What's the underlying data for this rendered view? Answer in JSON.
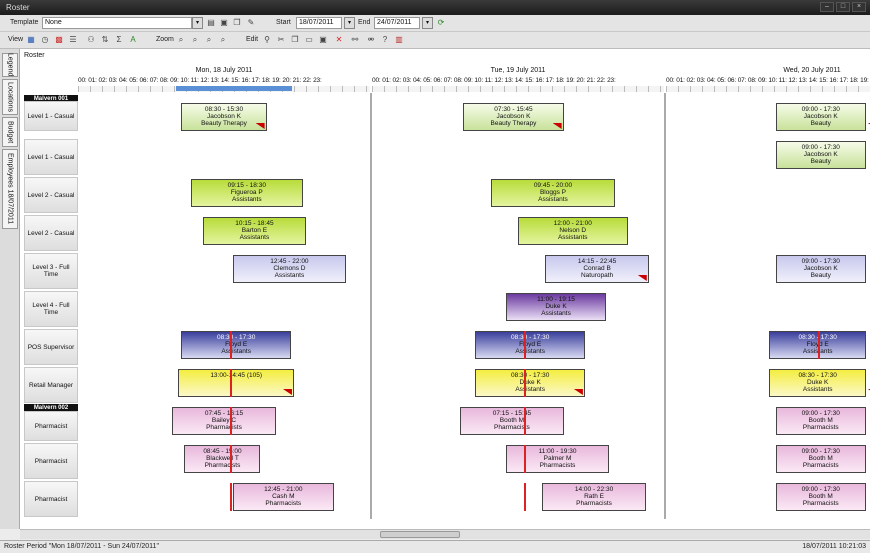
{
  "window": {
    "title": "Roster"
  },
  "toolbar1": {
    "template_label": "Template",
    "template_value": "None",
    "start_label": "Start",
    "start_value": "18/07/2011",
    "end_label": "End",
    "end_value": "24/07/2011"
  },
  "toolbar2": {
    "view_label": "View",
    "zoom_label": "Zoom",
    "edit_label": "Edit"
  },
  "sidetabs": [
    "Legend",
    "Locations",
    "Budget",
    "Employees 18/07/2011"
  ],
  "panel": {
    "title": "Roster"
  },
  "days": [
    "Mon, 18 July 2011",
    "Tue, 19 July 2011",
    "Wed, 20 July 2011"
  ],
  "hours": "00: 01: 02: 03: 04: 05: 06: 07: 08: 09: 10: 11: 12: 13: 14: 15: 16: 17: 18: 19: 20: 21: 22: 23:",
  "groups": [
    "Malvern 001",
    "Malvern 002"
  ],
  "rows": [
    "Level 1 - Casual",
    "Level 1 - Casual",
    "Level 2 - Casual",
    "Level 2 - Casual",
    "Level 3 - Full Time",
    "Level 4 - Full Time",
    "POS Supervisor",
    "Retail Manager",
    "Pharmacist",
    "Pharmacist",
    "Pharmacist"
  ],
  "shifts": [
    {
      "row": 0,
      "day": 0,
      "start": 8.5,
      "end": 15.5,
      "time": "08:30 - 15:30",
      "name": "Jacobson K",
      "role": "Beauty Therapy",
      "color": "green"
    },
    {
      "row": 0,
      "day": 1,
      "start": 7.5,
      "end": 15.75,
      "time": "07:30 - 15:45",
      "name": "Jacobson K",
      "role": "Beauty Therapy",
      "color": "green"
    },
    {
      "row": 0,
      "day": 2,
      "start": 9,
      "end": 17.5,
      "time": "09:00 - 17:30",
      "name": "Jacobson K",
      "role": "Beauty",
      "color": "green"
    },
    {
      "row": 1,
      "day": 2,
      "start": 9,
      "end": 17.5,
      "time": "09:00 - 17:30",
      "name": "Jacobson K",
      "role": "Beauty",
      "color": "green"
    },
    {
      "row": 2,
      "day": 0,
      "start": 9.25,
      "end": 18.5,
      "time": "09:15 - 18:30",
      "name": "Figueroa P",
      "role": "Assistants",
      "color": "lime"
    },
    {
      "row": 2,
      "day": 1,
      "start": 9.75,
      "end": 20,
      "time": "09:45 - 20:00",
      "name": "Bloggs P",
      "role": "Assistants",
      "color": "lime"
    },
    {
      "row": 3,
      "day": 0,
      "start": 10.25,
      "end": 18.75,
      "time": "10:15 - 18:45",
      "name": "Barton E",
      "role": "Assistants",
      "color": "lime"
    },
    {
      "row": 3,
      "day": 1,
      "start": 12,
      "end": 21,
      "time": "12:00 - 21:00",
      "name": "Nelson D",
      "role": "Assistants",
      "color": "lime"
    },
    {
      "row": 4,
      "day": 0,
      "start": 12.75,
      "end": 22,
      "time": "12:45 - 22:00",
      "name": "Clemons D",
      "role": "Assistants",
      "color": "lav"
    },
    {
      "row": 4,
      "day": 1,
      "start": 14.25,
      "end": 22.75,
      "time": "14:15 - 22:45",
      "name": "Conrad B",
      "role": "Naturopath",
      "color": "lav"
    },
    {
      "row": 4,
      "day": 2,
      "start": 9,
      "end": 17.5,
      "time": "09:00 - 17:30",
      "name": "Jacobson K",
      "role": "Beauty",
      "color": "lav"
    },
    {
      "row": 5,
      "day": 1,
      "start": 11,
      "end": 19.25,
      "time": "11:00 - 19:15",
      "name": "Duke K",
      "role": "Assistants",
      "color": "purple"
    },
    {
      "row": 6,
      "day": 0,
      "start": 8.5,
      "end": 17.5,
      "time": "08:30 - 17:30",
      "name": "Floyd E",
      "role": "Assistants",
      "color": "blue"
    },
    {
      "row": 6,
      "day": 1,
      "start": 8.5,
      "end": 17.5,
      "time": "08:30 - 17:30",
      "name": "Floyd E",
      "role": "Assistants",
      "color": "blue"
    },
    {
      "row": 6,
      "day": 2,
      "start": 8.5,
      "end": 17.5,
      "time": "08:30 - 17:30",
      "name": "Floyd E",
      "role": "Assistants",
      "color": "blue"
    },
    {
      "row": 7,
      "day": 0,
      "start": 8.25,
      "end": 17.75,
      "time": "13:00-14:45 (105)",
      "name": "",
      "role": "",
      "color": "yellow"
    },
    {
      "row": 7,
      "day": 1,
      "start": 8.5,
      "end": 17.5,
      "time": "08:30 - 17:30",
      "name": "Duke K",
      "role": "Assistants",
      "color": "yellow"
    },
    {
      "row": 7,
      "day": 2,
      "start": 8.5,
      "end": 17.5,
      "time": "08:30 - 17:30",
      "name": "Duke K",
      "role": "Assistants",
      "color": "yellow"
    },
    {
      "row": 8,
      "day": 0,
      "start": 7.75,
      "end": 16.25,
      "time": "07:45 - 16:15",
      "name": "Bailey C",
      "role": "Pharmacists",
      "color": "pink"
    },
    {
      "row": 8,
      "day": 1,
      "start": 7.25,
      "end": 15.75,
      "time": "07:15 - 15:45",
      "name": "Booth M",
      "role": "Pharmacists",
      "color": "pink"
    },
    {
      "row": 8,
      "day": 2,
      "start": 9,
      "end": 17.5,
      "time": "09:00 - 17:30",
      "name": "Booth M",
      "role": "Pharmacists",
      "color": "pink"
    },
    {
      "row": 9,
      "day": 0,
      "start": 8.75,
      "end": 15,
      "time": "08:45 - 15:00",
      "name": "Blackwell T",
      "role": "Pharmacists",
      "color": "pink"
    },
    {
      "row": 9,
      "day": 1,
      "start": 11,
      "end": 19.5,
      "time": "11:00 - 19:30",
      "name": "Palmer M",
      "role": "Pharmacists",
      "color": "pink"
    },
    {
      "row": 9,
      "day": 2,
      "start": 9,
      "end": 17.5,
      "time": "09:00 - 17:30",
      "name": "Booth M",
      "role": "Pharmacists",
      "color": "pink"
    },
    {
      "row": 10,
      "day": 0,
      "start": 12.75,
      "end": 21,
      "time": "12:45 - 21:00",
      "name": "Cash M",
      "role": "Pharmacists",
      "color": "pink"
    },
    {
      "row": 10,
      "day": 1,
      "start": 14,
      "end": 22.5,
      "time": "14:00 - 22:30",
      "name": "Rath E",
      "role": "Pharmacists",
      "color": "pink"
    },
    {
      "row": 10,
      "day": 2,
      "start": 9,
      "end": 17.5,
      "time": "09:00 - 17:30",
      "name": "Booth M",
      "role": "Pharmacists",
      "color": "pink"
    }
  ],
  "status": {
    "period": "Roster Period \"Mon 18/07/2011 - Sun 24/07/2011\"",
    "datetime": "18/07/2011 10:21:03"
  }
}
